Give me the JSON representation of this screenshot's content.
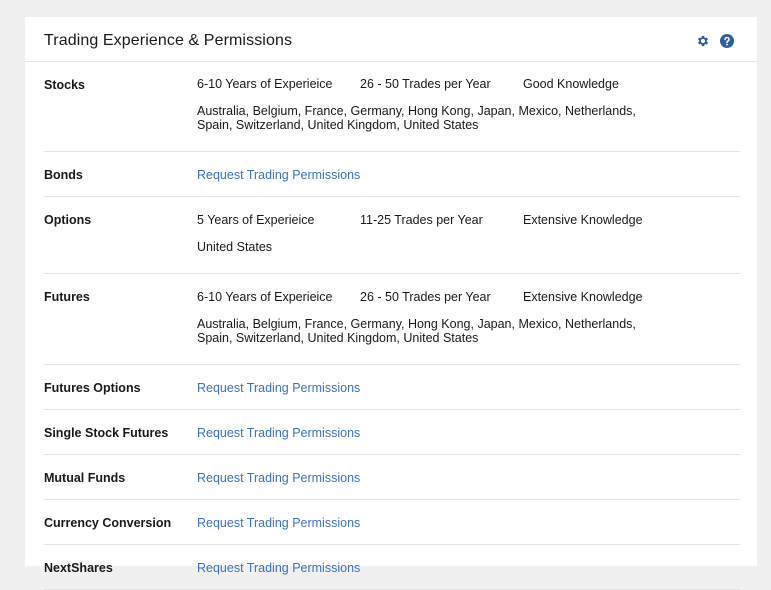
{
  "header": {
    "title": "Trading Experience & Permissions",
    "icons": [
      "gear-icon",
      "help-icon"
    ]
  },
  "colors": {
    "link": "#3d73b8",
    "accent": "#2f5f9e"
  },
  "rows": [
    {
      "label": "Stocks",
      "years": "6-10 Years of Experieice",
      "trades": "26 - 50 Trades per Year",
      "knowledge": "Good Knowledge",
      "countries": "Australia, Belgium, France, Germany, Hong Kong, Japan, Mexico, Netherlands, Spain, Switzerland, United Kingdom, United States"
    },
    {
      "label": "Bonds",
      "link": "Request Trading Permissions"
    },
    {
      "label": "Options",
      "years": "5 Years of Experieice",
      "trades": "11-25 Trades per Year",
      "knowledge": "Extensive Knowledge",
      "countries": "United States"
    },
    {
      "label": "Futures",
      "years": "6-10 Years of Experieice",
      "trades": "26 - 50 Trades per Year",
      "knowledge": "Extensive Knowledge",
      "countries": "Australia, Belgium, France, Germany, Hong Kong, Japan, Mexico, Netherlands, Spain, Switzerland, United Kingdom, United States"
    },
    {
      "label": "Futures Options",
      "link": "Request Trading Permissions"
    },
    {
      "label": "Single Stock Futures",
      "link": "Request Trading Permissions"
    },
    {
      "label": "Mutual Funds",
      "link": "Request Trading Permissions"
    },
    {
      "label": "Currency Conversion",
      "link": "Request Trading Permissions"
    },
    {
      "label": "NextShares",
      "link": "Request Trading Permissions"
    }
  ]
}
